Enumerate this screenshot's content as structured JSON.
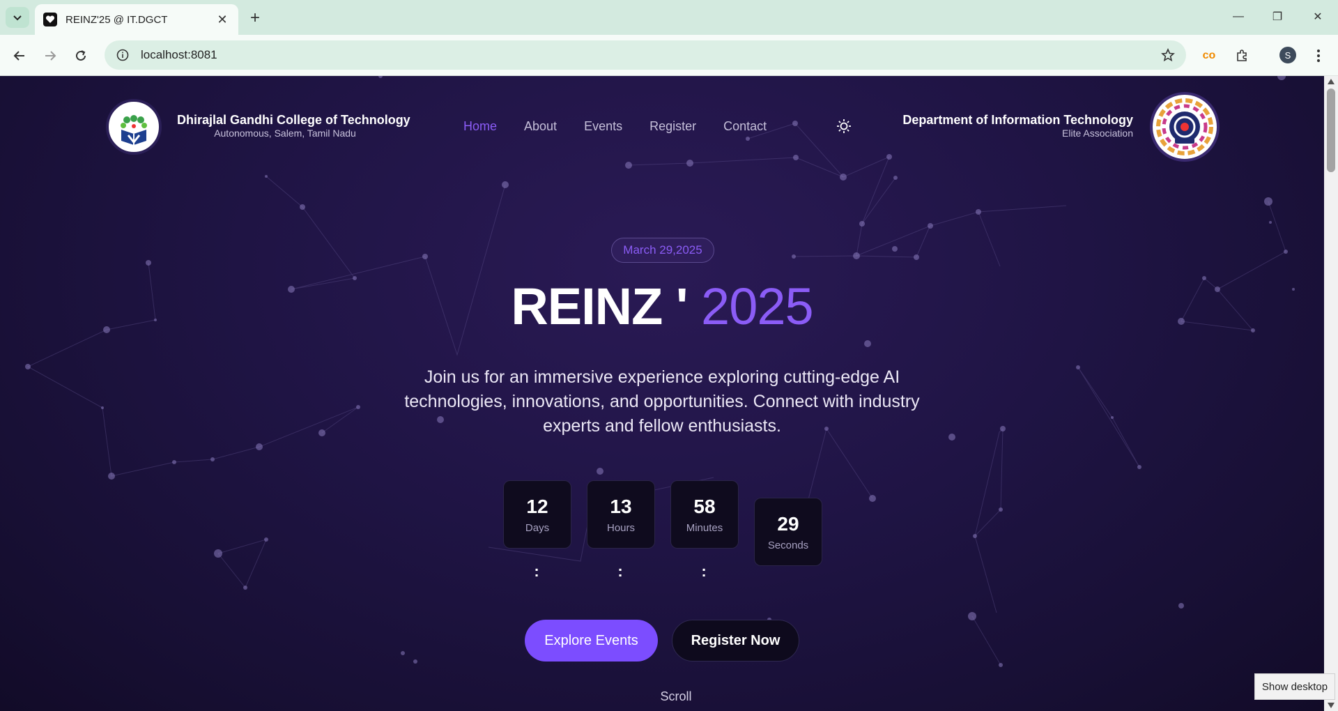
{
  "browser": {
    "tab_title": "REINZ'25 @ IT.DGCT",
    "url": "localhost:8081",
    "profile_initial": "S"
  },
  "header": {
    "college_name": "Dhirajlal Gandhi College of Technology",
    "college_sub": "Autonomous, Salem, Tamil Nadu",
    "dept_name": "Department of Information Technology",
    "dept_sub": "Elite Association",
    "nav": [
      "Home",
      "About",
      "Events",
      "Register",
      "Contact"
    ],
    "active_nav": "Home"
  },
  "hero": {
    "date": "March 29,2025",
    "title_main": "REINZ '",
    "title_year": "2025",
    "description": "Join us for an immersive experience exploring cutting-edge AI technologies, innovations, and opportunities. Connect with industry experts and fellow enthusiasts.",
    "countdown": [
      {
        "value": "12",
        "label": "Days"
      },
      {
        "value": "13",
        "label": "Hours"
      },
      {
        "value": "58",
        "label": "Minutes"
      },
      {
        "value": "29",
        "label": "Seconds"
      }
    ],
    "separator": ":",
    "primary_button": "Explore Events",
    "secondary_button": "Register Now",
    "scroll_label": "Scroll"
  },
  "taskbar_tooltip": "Show desktop",
  "colors": {
    "accent": "#8b5cf6",
    "button_primary": "#7c4dff",
    "background": "#1f1444"
  }
}
